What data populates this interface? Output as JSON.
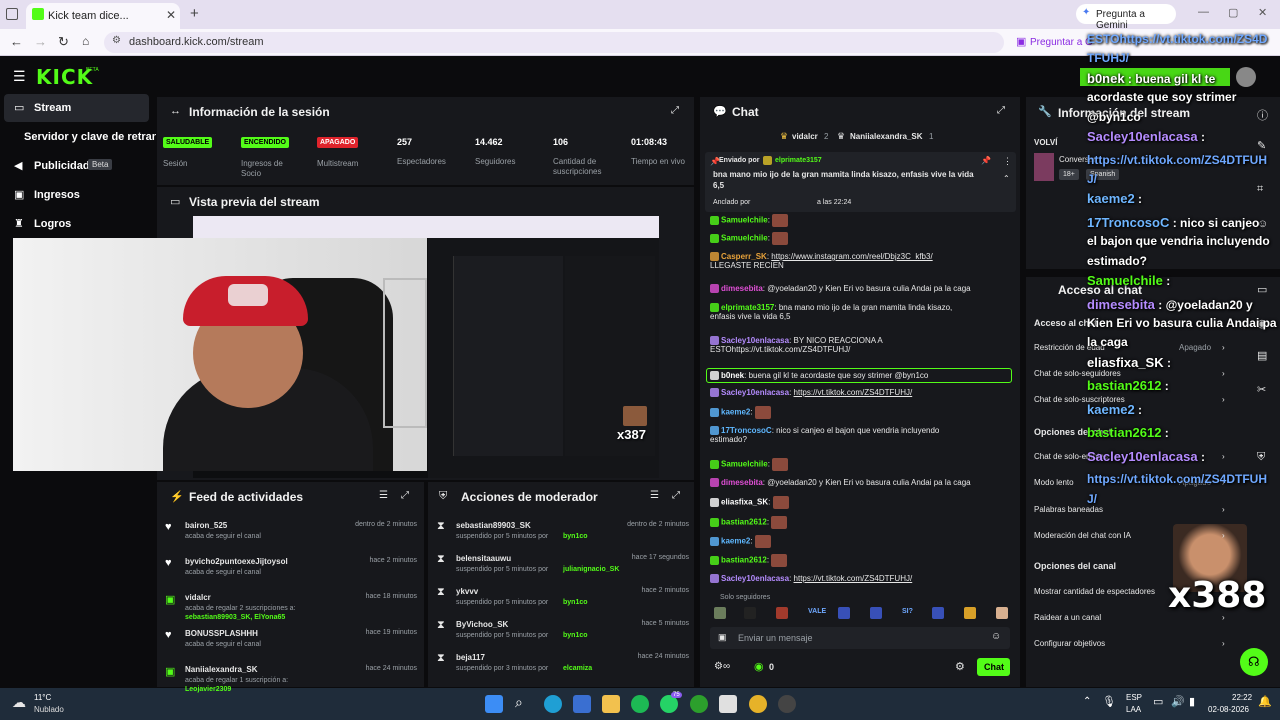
{
  "browser": {
    "tab_title": "Kick team dice...",
    "gemini": "Pregunta a Gemini",
    "url": "dashboard.kick.com/stream",
    "gemini_url": "Preguntar a G"
  },
  "logo": "KICK",
  "beta_sup": "BETA",
  "nav": {
    "items": [
      {
        "label": "Stream"
      },
      {
        "label": "Servidor y clave de retransm"
      },
      {
        "label": "Publicidad",
        "badge": "Beta"
      },
      {
        "label": "Ingresos"
      },
      {
        "label": "Logros"
      }
    ]
  },
  "session": {
    "title": "Información de la sesión",
    "stats": [
      {
        "value": "SALUDABLE",
        "label": "Sesión",
        "color": "#53fc18"
      },
      {
        "value": "ENCENDIDO",
        "label": "Ingresos de Socio",
        "color": "#53fc18"
      },
      {
        "value": "APAGADO",
        "label": "Multistream",
        "color": "#e0242c"
      },
      {
        "value": "257",
        "label": "Espectadores"
      },
      {
        "value": "14.462",
        "label": "Seguidores"
      },
      {
        "value": "106",
        "label": "Cantidad de suscripciones"
      },
      {
        "value": "01:08:43",
        "label": "Tiempo en vivo"
      }
    ]
  },
  "preview": {
    "title": "Vista previa del stream",
    "combo": "x387"
  },
  "feed": {
    "title": "Feed de actividades",
    "items": [
      {
        "user": "bairon_525",
        "time": "dentro de 2 minutos",
        "desc": "acaba de seguir el canal",
        "kind": "heart"
      },
      {
        "user": "byvicho2puntoexeJijtoysol",
        "time": "hace 2 minutos",
        "desc": "acaba de seguir el canal",
        "kind": "heart"
      },
      {
        "user": "vidalcr",
        "time": "hace 18 minutos",
        "desc": "acaba de regalar 2 suscripciones a:",
        "extra": "sebastian89903_SK, ElYona65",
        "kind": "gift"
      },
      {
        "user": "BONUSSPLASHHH",
        "time": "hace 19 minutos",
        "desc": "acaba de seguir el canal",
        "kind": "heart"
      },
      {
        "user": "Naniialexandra_SK",
        "time": "hace 24 minutos",
        "desc": "acaba de regalar 1 suscripción a:",
        "extra": "Leojavier2309",
        "kind": "gift"
      }
    ]
  },
  "mod": {
    "title": "Acciones de moderador",
    "items": [
      {
        "user": "sebastian89903_SK",
        "time": "dentro de 2 minutos",
        "desc": "suspendido por 5 minutos por",
        "by": "byn1co"
      },
      {
        "user": "belensitaauwu",
        "time": "hace 17 segundos",
        "desc": "suspendido por 5 minutos por",
        "by": "julianignacio_SK"
      },
      {
        "user": "ykvvv",
        "time": "hace 2 minutos",
        "desc": "suspendido por 5 minutos por",
        "by": "byn1co"
      },
      {
        "user": "ByVichoo_SK",
        "time": "hace 5 minutos",
        "desc": "suspendido por 5 minutos por",
        "by": "byn1co"
      },
      {
        "user": "beja117",
        "time": "hace 24 minutos",
        "desc": "suspendido por 3 minutos por",
        "by": "elcamiza"
      }
    ]
  },
  "chat": {
    "title": "Chat",
    "top_gifters": [
      "vidalcr",
      "2",
      "Naniialexandra_SK",
      "1"
    ],
    "pinned": {
      "sent_by": "Enviado por",
      "user": "elprimate3157",
      "text": "bna mano mio ijo de la gran mamita linda kisazo, enfasis vive la vida 6,5",
      "pinned_by": "Anclado por",
      "pinned_time": "a las 22:24"
    },
    "messages": [
      {
        "user": "Samuelchile",
        "text": "",
        "color": "#53fc18"
      },
      {
        "user": "Samuelchile",
        "text": "",
        "color": "#53fc18"
      },
      {
        "user": "Casperr_SK",
        "text": "https://www.instagram.com/reel/Dbjz3C_kfb3/",
        "text2": "LLEGASTE RECIEN",
        "color": "#e8a23a"
      },
      {
        "user": "dimesebita",
        "text": "@yoeladan20 y Kien Eri vo basura culia Andai pa la caga",
        "color": "#e04fd6"
      },
      {
        "user": "elprimate3157",
        "text": "bna mano mio ijo de la gran mamita linda kisazo,",
        "text2": "enfasis vive la vida 6,5",
        "color": "#53fc18"
      },
      {
        "user": "Sacley10enlacasa",
        "text": "BY NICO REACCIONA A",
        "text2": "ESTOhttps://vt.tiktok.com/ZS4DTFUHJ/",
        "color": "#b58cff"
      },
      {
        "user": "b0nek",
        "text": "buena gil kl te acordaste que soy strimer @byn1co",
        "color": "#fff"
      },
      {
        "user": "Sacley10enlacasa",
        "text": "https://vt.tiktok.com/ZS4DTFUHJ/",
        "color": "#b58cff"
      },
      {
        "user": "kaeme2",
        "text": "",
        "color": "#5fb8ff"
      },
      {
        "user": "17TroncosoC",
        "text": "nico si canjeo el bajon que vendria incluyendo",
        "text2": "estimado?",
        "color": "#5fb8ff"
      },
      {
        "user": "Samuelchile",
        "text": "",
        "color": "#53fc18"
      },
      {
        "user": "dimesebita",
        "text": "@yoeladan20 y Kien Eri vo basura culia Andai pa la caga",
        "color": "#e04fd6"
      },
      {
        "user": "eliasfixa_SK",
        "text": "",
        "color": "#fff"
      },
      {
        "user": "bastian2612",
        "text": "",
        "color": "#53fc18"
      },
      {
        "user": "kaeme2",
        "text": "",
        "color": "#5fb8ff"
      },
      {
        "user": "bastian2612",
        "text": "",
        "color": "#53fc18"
      },
      {
        "user": "Sacley10enlacasa",
        "text": "https://vt.tiktok.com/ZS4DTFUHJ/",
        "color": "#b58cff"
      }
    ],
    "followers_only": "Solo seguidores",
    "emotes": [
      "VALE",
      "SI?"
    ],
    "input_placeholder": "Enviar un mensaje",
    "points": "0",
    "send": "Chat"
  },
  "right": {
    "stream_info_title": "Información del stream",
    "stream_title": "VOLVÍ",
    "category": "Conversar",
    "tags": [
      "18+",
      "Spanish"
    ],
    "chat_access_title": "Acceso al chat",
    "settings": [
      {
        "label": "Acceso al chat",
        "header": true
      },
      {
        "label": "Restricción de edad",
        "value": "Apagado"
      },
      {
        "label": "Chat de solo-seguidores"
      },
      {
        "label": "Chat de solo-suscriptores"
      },
      {
        "label": "Opciones del chat",
        "header": true
      },
      {
        "label": "Chat de solo-emotes"
      },
      {
        "label": "Modo lento",
        "value": "Apagado"
      },
      {
        "label": "Palabras baneadas"
      },
      {
        "label": "Moderación del chat con IA"
      },
      {
        "label": "Opciones del canal",
        "header": true
      },
      {
        "label": "Mostrar cantidad de espectadores"
      },
      {
        "label": "Raidear a un canal"
      },
      {
        "label": "Configurar objetivos"
      }
    ],
    "combo": "x388"
  },
  "overlay": {
    "lines": [
      {
        "u": "",
        "t": "ESTOhttps://vt.tiktok.com/ZS4D"
      },
      {
        "u": "",
        "t": "TFUHJ/"
      },
      {
        "u": "b0nek",
        "t": "buena gil kl te"
      },
      {
        "u": "",
        "t": "acordaste que soy strimer"
      },
      {
        "u": "",
        "t": "@byn1co"
      },
      {
        "u": "Sacley10enlacasa",
        "t": ""
      },
      {
        "u": "",
        "t": "https://vt.tiktok.com/ZS4DTFUH"
      },
      {
        "u": "",
        "t": "J/"
      },
      {
        "u": "kaeme2",
        "t": ""
      },
      {
        "u": "17TroncosoC",
        "t": "nico si canjeo"
      },
      {
        "u": "",
        "t": "el bajon que vendria incluyendo"
      },
      {
        "u": "",
        "t": "estimado?"
      },
      {
        "u": "Samuelchile",
        "t": ""
      },
      {
        "u": "dimesebita",
        "t": "@yoeladan20 y"
      },
      {
        "u": "",
        "t": "Kien Eri vo basura culia Andai pa"
      },
      {
        "u": "",
        "t": "la caga"
      },
      {
        "u": "eliasfixa_SK",
        "t": ""
      },
      {
        "u": "bastian2612",
        "t": ""
      },
      {
        "u": "kaeme2",
        "t": ""
      },
      {
        "u": "bastian2612",
        "t": ""
      },
      {
        "u": "Sacley10enlacasa",
        "t": ""
      },
      {
        "u": "",
        "t": "https://vt.tiktok.com/ZS4DTFUH"
      },
      {
        "u": "",
        "t": "J/"
      }
    ]
  },
  "taskbar": {
    "temp": "11°C",
    "weather": "Nublado",
    "lang1": "ESP",
    "lang2": "LAA",
    "time": "22:22",
    "date": "02-08-2026",
    "notif": "75"
  }
}
